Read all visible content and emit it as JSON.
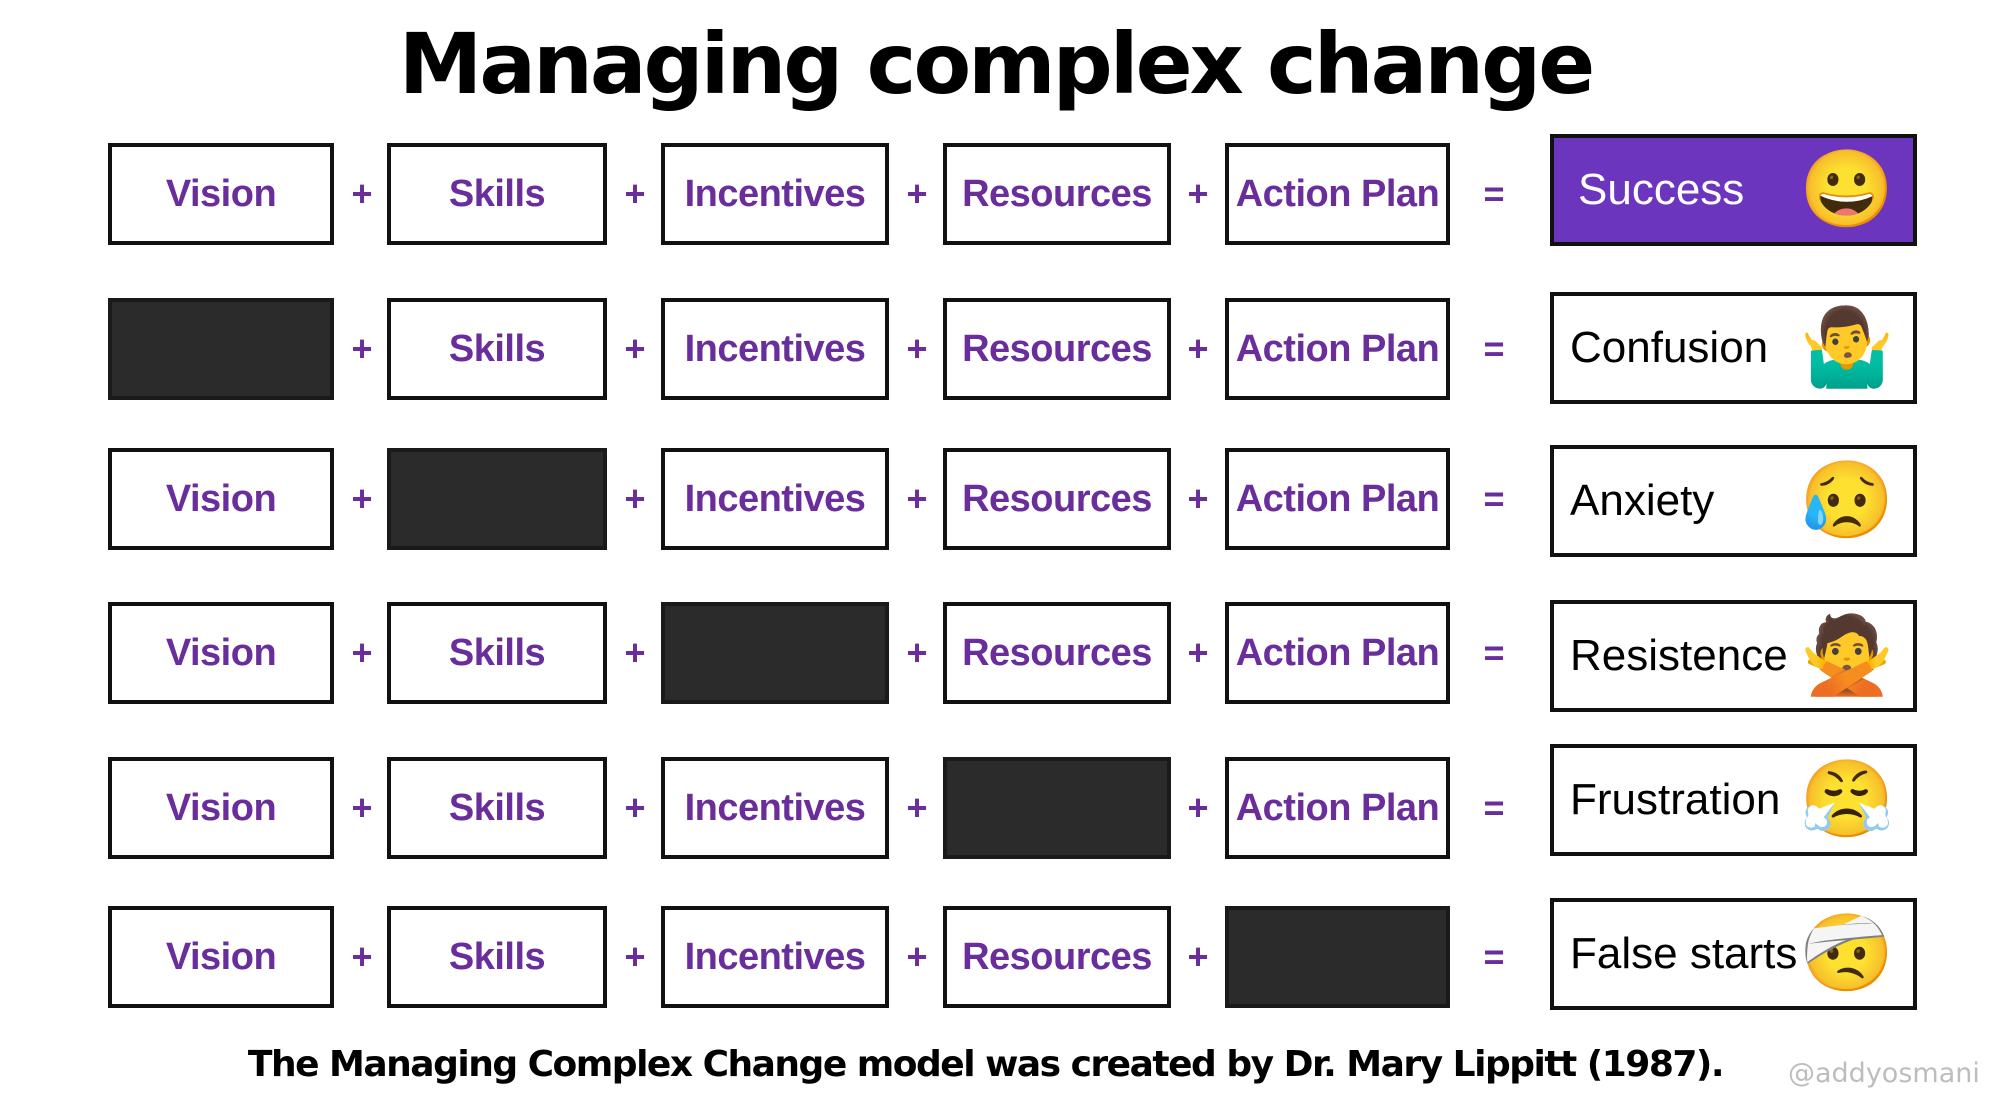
{
  "title": "Managing complex change",
  "operators": {
    "plus": "+",
    "equals": "="
  },
  "colors": {
    "accent_purple": "#6c35be",
    "factor_text": "#6a2d9c",
    "missing_fill": "#2b2b2b"
  },
  "rows": [
    {
      "factors": [
        "Vision",
        "Skills",
        "Incentives",
        "Resources",
        "Action Plan"
      ],
      "missing": null,
      "result": {
        "label": "Success",
        "emoji": "😀",
        "emoji_name": "grinning-face-icon",
        "highlight": true
      }
    },
    {
      "factors": [
        "",
        "Skills",
        "Incentives",
        "Resources",
        "Action Plan"
      ],
      "missing": "Vision",
      "result": {
        "label": "Confusion",
        "emoji": "🤷‍♂️",
        "emoji_name": "man-shrugging-icon",
        "highlight": false
      }
    },
    {
      "factors": [
        "Vision",
        "",
        "Incentives",
        "Resources",
        "Action Plan"
      ],
      "missing": "Skills",
      "result": {
        "label": "Anxiety",
        "emoji": "😥",
        "emoji_name": "sad-relieved-face-icon",
        "highlight": false
      }
    },
    {
      "factors": [
        "Vision",
        "Skills",
        "",
        "Resources",
        "Action Plan"
      ],
      "missing": "Incentives",
      "result": {
        "label": "Resistence",
        "emoji": "🙅",
        "emoji_name": "person-gesturing-no-icon",
        "highlight": false
      }
    },
    {
      "factors": [
        "Vision",
        "Skills",
        "Incentives",
        "",
        "Action Plan"
      ],
      "missing": "Resources",
      "result": {
        "label": "Frustration",
        "emoji": "😤",
        "emoji_name": "face-with-steam-icon",
        "highlight": false
      }
    },
    {
      "factors": [
        "Vision",
        "Skills",
        "Incentives",
        "Resources",
        ""
      ],
      "missing": "Action Plan",
      "result": {
        "label": "False starts",
        "emoji": "🤕",
        "emoji_name": "face-with-head-bandage-icon",
        "highlight": false
      }
    }
  ],
  "footer": "The Managing Complex Change model was created by Dr. Mary Lippitt (1987).",
  "watermark": "@addyosmani"
}
